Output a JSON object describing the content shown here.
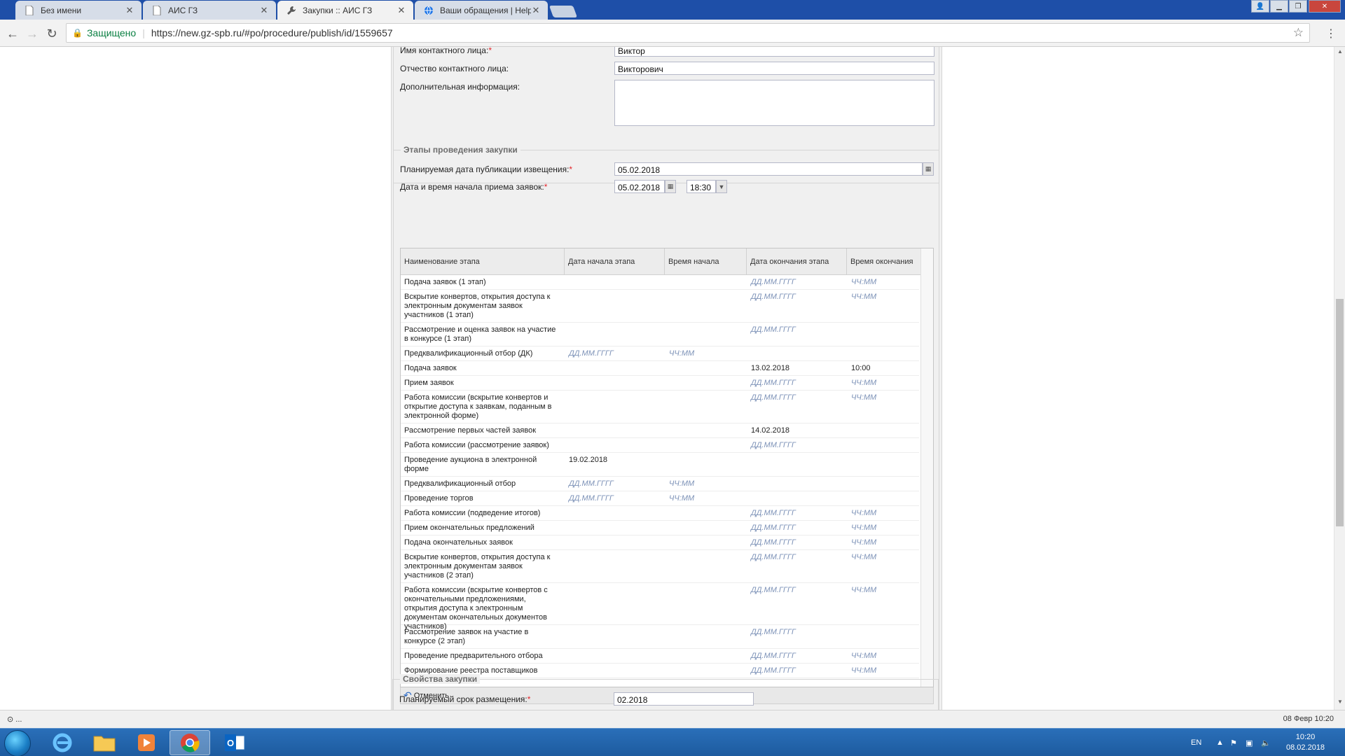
{
  "browser": {
    "tabs": [
      {
        "title": "Без имени",
        "icon": "document-icon"
      },
      {
        "title": "АИС ГЗ",
        "icon": "document-icon"
      },
      {
        "title": "Закупки :: АИС ГЗ",
        "icon": "wrench-icon"
      },
      {
        "title": "Ваши обращения | Help",
        "icon": "globe-icon"
      }
    ],
    "secure_label": "Защищено",
    "url": "https://new.gz-spb.ru/#po/procedure/publish/id/1559657"
  },
  "contact": {
    "first_name_label": "Имя контактного лица:",
    "first_name_value": "Виктор",
    "patronymic_label": "Отчество контактного лица:",
    "patronymic_value": "Викторович",
    "extra_info_label": "Дополнительная информация:"
  },
  "stages": {
    "legend": "Этапы проведения закупки",
    "publication_date_label": "Планируемая дата публикации извещения:",
    "publication_date_value": "05.02.2018",
    "start_label": "Дата и время начала приема заявок:",
    "start_date_value": "05.02.2018",
    "start_time_value": "18:30",
    "columns": [
      "Наименование этапа",
      "Дата начала этапа",
      "Время начала",
      "Дата окончания этапа",
      "Время окончания"
    ],
    "rows": [
      {
        "name": "Подача заявок (1 этап)",
        "sd": "",
        "st": "",
        "ed": "ДД.ММ.ГГГГ",
        "et": "ЧЧ:ММ"
      },
      {
        "name": "Вскрытие конвертов, открытия доступа к электронным документам заявок участников (1 этап)",
        "sd": "",
        "st": "",
        "ed": "ДД.ММ.ГГГГ",
        "et": "ЧЧ:ММ"
      },
      {
        "name": "Рассмотрение и оценка заявок на участие в конкурсе (1 этап)",
        "sd": "",
        "st": "",
        "ed": "ДД.ММ.ГГГГ",
        "et": ""
      },
      {
        "name": "Предквалификационный отбор (ДК)",
        "sd": "ДД.ММ.ГГГГ",
        "st": "ЧЧ:ММ",
        "ed": "",
        "et": ""
      },
      {
        "name": "Подача заявок",
        "sd": "",
        "st": "",
        "ed": "13.02.2018",
        "et": "10:00"
      },
      {
        "name": "Прием заявок",
        "sd": "",
        "st": "",
        "ed": "ДД.ММ.ГГГГ",
        "et": "ЧЧ:ММ"
      },
      {
        "name": "Работа комиссии (вскрытие конвертов и открытие доступа к заявкам, поданным в электронной форме)",
        "sd": "",
        "st": "",
        "ed": "ДД.ММ.ГГГГ",
        "et": "ЧЧ:ММ"
      },
      {
        "name": "Рассмотрение первых частей заявок",
        "sd": "",
        "st": "",
        "ed": "14.02.2018",
        "et": ""
      },
      {
        "name": "Работа комиссии (рассмотрение заявок)",
        "sd": "",
        "st": "",
        "ed": "ДД.ММ.ГГГГ",
        "et": ""
      },
      {
        "name": "Проведение аукциона в электронной форме",
        "sd": "19.02.2018",
        "st": "",
        "ed": "",
        "et": ""
      },
      {
        "name": "Предквалификационный отбор",
        "sd": "ДД.ММ.ГГГГ",
        "st": "ЧЧ:ММ",
        "ed": "",
        "et": ""
      },
      {
        "name": "Проведение торгов",
        "sd": "ДД.ММ.ГГГГ",
        "st": "ЧЧ:ММ",
        "ed": "",
        "et": ""
      },
      {
        "name": "Работа комиссии (подведение итогов)",
        "sd": "",
        "st": "",
        "ed": "ДД.ММ.ГГГГ",
        "et": "ЧЧ:ММ"
      },
      {
        "name": "Прием окончательных предложений",
        "sd": "",
        "st": "",
        "ed": "ДД.ММ.ГГГГ",
        "et": "ЧЧ:ММ"
      },
      {
        "name": "Подача окончательных заявок",
        "sd": "",
        "st": "",
        "ed": "ДД.ММ.ГГГГ",
        "et": "ЧЧ:ММ"
      },
      {
        "name": "Вскрытие конвертов, открытия доступа к электронным документам заявок участников (2 этап)",
        "sd": "",
        "st": "",
        "ed": "ДД.ММ.ГГГГ",
        "et": "ЧЧ:ММ"
      },
      {
        "name": "Работа комиссии (вскрытие конвертов с окончательными предложениями, открытия доступа к электронным документам окончательных документов участников)",
        "sd": "",
        "st": "",
        "ed": "ДД.ММ.ГГГГ",
        "et": "ЧЧ:ММ"
      },
      {
        "name": "Рассмотрение заявок на участие в конкурсе (2 этап)",
        "sd": "",
        "st": "",
        "ed": "ДД.ММ.ГГГГ",
        "et": ""
      },
      {
        "name": "Проведение предварительного отбора",
        "sd": "",
        "st": "",
        "ed": "ДД.ММ.ГГГГ",
        "et": "ЧЧ:ММ"
      },
      {
        "name": "Формирование реестра поставщиков",
        "sd": "",
        "st": "",
        "ed": "ДД.ММ.ГГГГ",
        "et": "ЧЧ:ММ"
      }
    ],
    "cancel_label": "Отменить"
  },
  "properties": {
    "legend": "Свойства закупки",
    "term_label": "Планируемый срок размещения:",
    "term_value": "02.2018"
  },
  "statusbar": {
    "left": "...",
    "right": "08 Февр 10:20"
  },
  "taskbar": {
    "lang": "EN",
    "time": "10:20",
    "date": "08.02.2018"
  }
}
